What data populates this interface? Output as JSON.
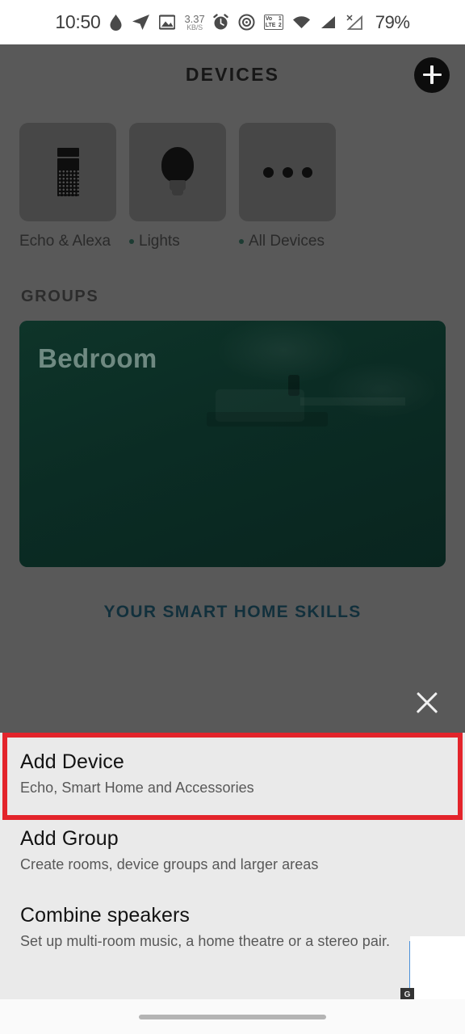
{
  "statusbar": {
    "time": "10:50",
    "icons": [
      "water-drop-icon",
      "telegram-icon",
      "image-icon"
    ],
    "network_rate_value": "3.37",
    "network_rate_unit": "KB/S",
    "alarm_icon": "alarm-clock-icon",
    "location_icon": "location-tracking-icon",
    "volte_top": "Vo",
    "volte_bottom": "LTE",
    "volte_sim_top": "1",
    "volte_sim_bottom": "2",
    "wifi_icon": "wifi-icon",
    "signal_icon": "signal-bars-icon",
    "signal_off_icon": "signal-no-service-icon",
    "battery": "79%"
  },
  "header": {
    "title": "DEVICES",
    "add_button_label": "+"
  },
  "categories": [
    {
      "label": "Echo & Alexa",
      "icon": "echo-speaker-icon",
      "has_status_dot": false
    },
    {
      "label": "Lights",
      "icon": "light-bulb-icon",
      "has_status_dot": true
    },
    {
      "label": "All Devices",
      "icon": "more-dots-icon",
      "has_status_dot": true
    }
  ],
  "groups": {
    "section_title": "GROUPS",
    "cards": [
      {
        "name": "Bedroom"
      }
    ]
  },
  "skills_link": "YOUR SMART HOME SKILLS",
  "close_button_label": "close-icon",
  "sheet": {
    "items": [
      {
        "title": "Add Device",
        "subtitle": "Echo, Smart Home and Accessories",
        "highlighted": true
      },
      {
        "title": "Add Group",
        "subtitle": "Create rooms, device groups and larger areas",
        "highlighted": false
      },
      {
        "title": "Combine speakers",
        "subtitle": "Set up multi-room music, a home theatre or a stereo pair.",
        "highlighted": false
      }
    ],
    "badge_label": "G"
  },
  "colors": {
    "highlight": "#e3242b",
    "sheet_bg": "#eaeaea",
    "scrim": "#595959",
    "tile": "#474747",
    "group_card": "#0d3028",
    "link": "#12303c",
    "accent_blue": "#4a90d9"
  }
}
